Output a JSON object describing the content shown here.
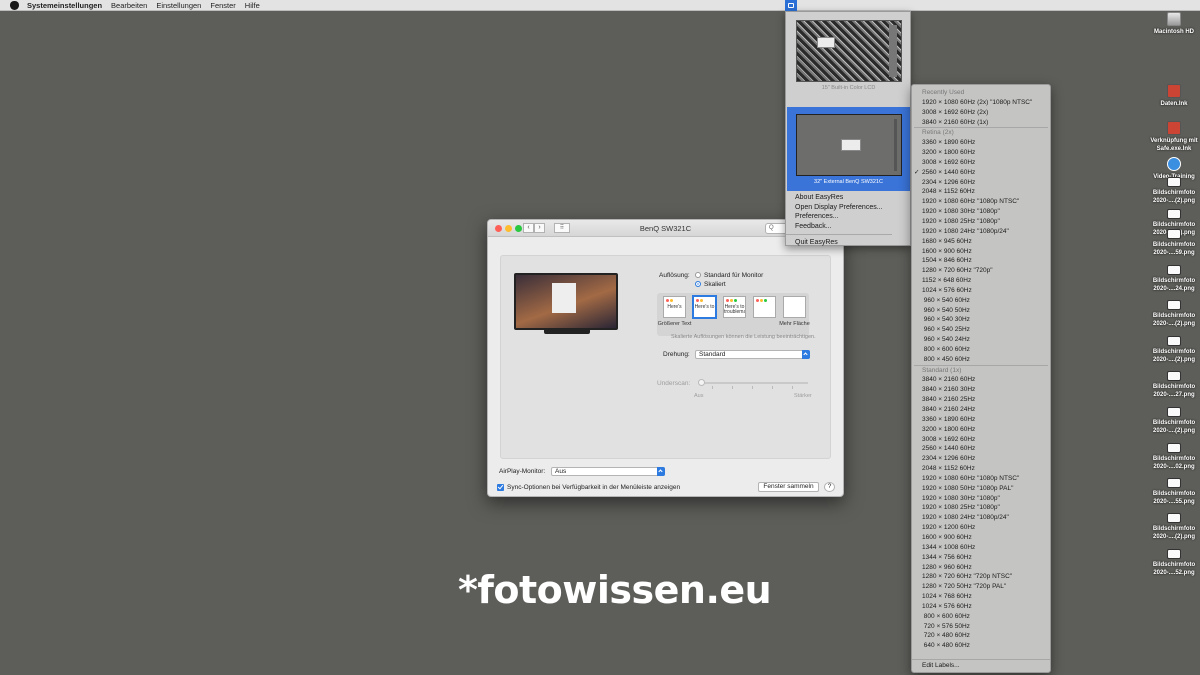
{
  "menubar": {
    "items": [
      "Systemeinstellungen",
      "Bearbeiten",
      "Einstellungen",
      "Fenster",
      "Hilfe"
    ]
  },
  "desktop_icons": [
    {
      "label": "Macintosh HD",
      "icon": "disk-icon"
    },
    {
      "label": "Daten.lnk",
      "icon": "alias-icon"
    },
    {
      "label": "Verknüpfung mit Safe.exe.lnk",
      "icon": "alias-icon"
    },
    {
      "label": "Video-Training",
      "icon": "play-icon"
    },
    {
      "label": "Bildschirmfoto 2020-....(2).png",
      "icon": "image-icon"
    },
    {
      "label": "Bildschirmfoto 2020-....(2).png",
      "icon": "image-icon"
    },
    {
      "label": "Bildschirmfoto 2020-....59.png",
      "icon": "image-icon"
    },
    {
      "label": "Bildschirmfoto 2020-....24.png",
      "icon": "image-icon"
    },
    {
      "label": "Bildschirmfoto 2020-....(2).png",
      "icon": "image-icon"
    },
    {
      "label": "Bildschirmfoto 2020-....(2).png",
      "icon": "image-icon"
    },
    {
      "label": "Bildschirmfoto 2020-....27.png",
      "icon": "image-icon"
    },
    {
      "label": "Bildschirmfoto 2020-....(2).png",
      "icon": "image-icon"
    },
    {
      "label": "Bildschirmfoto 2020-....02.png",
      "icon": "image-icon"
    },
    {
      "label": "Bildschirmfoto 2020-....55.png",
      "icon": "image-icon"
    },
    {
      "label": "Bildschirmfoto 2020-....(2).png",
      "icon": "image-icon"
    },
    {
      "label": "Bildschirmfoto 2020-....52.png",
      "icon": "image-icon"
    }
  ],
  "easyres": {
    "displays": [
      {
        "label": "15\" Built-in Color LCD",
        "selected": false
      },
      {
        "label": "32\" External BenQ SW321C",
        "selected": true
      }
    ],
    "links": [
      "About EasyRes",
      "Open Display Preferences...",
      "Preferences...",
      "Feedback..."
    ],
    "quit": "Quit EasyRes"
  },
  "resolution_menu": {
    "sections": [
      {
        "header": "Recently Used",
        "rows": [
          "1920 × 1080 60Hz (2x) \"1080p NTSC\"",
          "3008 × 1692 60Hz (2x)",
          "3840 × 2160 60Hz (1x)"
        ]
      },
      {
        "header": "Retina (2x)",
        "rows": [
          "3360 × 1890 60Hz",
          "3200 × 1800 60Hz",
          "3008 × 1692 60Hz",
          "2560 × 1440 60Hz",
          "2304 × 1296 60Hz",
          "2048 × 1152 60Hz",
          "1920 × 1080 60Hz \"1080p NTSC\"",
          "1920 × 1080 30Hz \"1080p\"",
          "1920 × 1080 25Hz \"1080p\"",
          "1920 × 1080 24Hz \"1080p/24\"",
          "1680 × 945 60Hz",
          "1600 × 900 60Hz",
          "1504 × 846 60Hz",
          "1280 × 720 60Hz \"720p\"",
          "1152 × 648 60Hz",
          "1024 × 576 60Hz",
          " 960 × 540 60Hz",
          " 960 × 540 50Hz",
          " 960 × 540 30Hz",
          " 960 × 540 25Hz",
          " 960 × 540 24Hz",
          " 800 × 600 60Hz",
          " 800 × 450 60Hz"
        ],
        "checked_index": 3
      },
      {
        "header": "Standard (1x)",
        "rows": [
          "3840 × 2160 60Hz",
          "3840 × 2160 30Hz",
          "3840 × 2160 25Hz",
          "3840 × 2160 24Hz",
          "3360 × 1890 60Hz",
          "3200 × 1800 60Hz",
          "3008 × 1692 60Hz",
          "2560 × 1440 60Hz",
          "2304 × 1296 60Hz",
          "2048 × 1152 60Hz",
          "1920 × 1080 60Hz \"1080p NTSC\"",
          "1920 × 1080 50Hz \"1080p PAL\"",
          "1920 × 1080 30Hz \"1080p\"",
          "1920 × 1080 25Hz \"1080p\"",
          "1920 × 1080 24Hz \"1080p/24\"",
          "1920 × 1200 60Hz",
          "1600 × 900 60Hz",
          "1344 × 1008 60Hz",
          "1344 × 756 60Hz",
          "1280 × 960 60Hz",
          "1280 × 720 60Hz \"720p NTSC\"",
          "1280 × 720 50Hz \"720p PAL\"",
          "1024 × 768 60Hz",
          "1024 × 576 60Hz",
          " 800 × 600 60Hz",
          " 720 × 576 50Hz",
          " 720 × 480 60Hz",
          " 640 × 480 60Hz"
        ]
      }
    ],
    "footer": "Edit Labels...",
    "check_mark": "✓"
  },
  "window": {
    "title": "BenQ SW321C",
    "search_placeholder": "Q",
    "tabs": [
      {
        "label": "Monitor",
        "active": true
      },
      {
        "label": "Anordnen",
        "active": false
      },
      {
        "label": "Farben",
        "active": false
      }
    ],
    "resolution_label": "Auflösung:",
    "option_default": "Standard für Monitor",
    "option_scaled": "Skaliert",
    "scaled_selected": true,
    "scale_option_texts": [
      "Here's",
      "Here's to",
      "Here's to troublema",
      ""
    ],
    "scale_larger": "Größerer Text",
    "scale_more": "Mehr Fläche",
    "scale_hint": "Skalierte Auflösungen können die Leistung beeinträchtigen.",
    "rotation_label": "Drehung:",
    "rotation_value": "Standard",
    "underscan_label": "Underscan:",
    "underscan_min": "Aus",
    "underscan_max": "Stärker",
    "airplay_label": "AirPlay-Monitor:",
    "airplay_value": "Aus",
    "sync_label": "Sync-Optionen bei Verfügbarkeit in der Menüleiste anzeigen",
    "sync_checked": true,
    "gather_button": "Fenster sammeln",
    "help_button": "?"
  },
  "watermark": "*fotowissen.eu",
  "colors": {
    "desktop": "#5d5d59",
    "accent": "#2d7be0",
    "selection": "#3a74d9"
  }
}
